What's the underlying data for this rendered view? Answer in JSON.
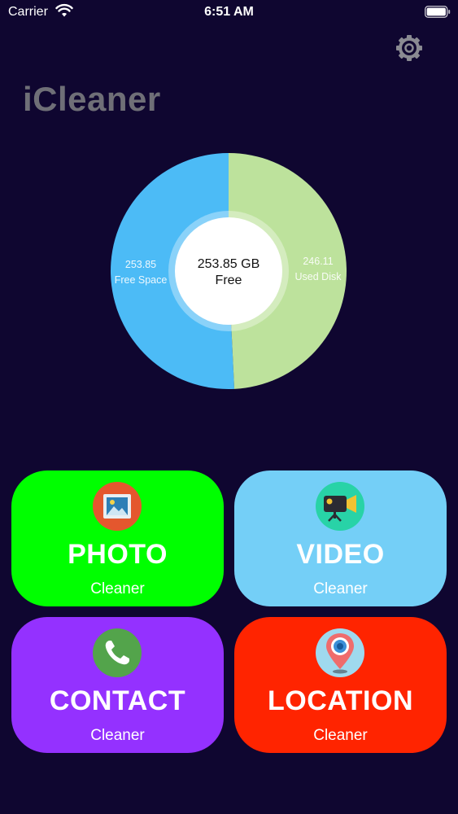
{
  "status_bar": {
    "carrier": "Carrier",
    "time": "6:51 AM"
  },
  "app": {
    "title": "iCleaner"
  },
  "disk": {
    "free_gb": 253.85,
    "used_gb": 246.11,
    "center_value": "253.85 GB",
    "center_label": "Free",
    "free_value": "253.85",
    "free_label": "Free Space",
    "used_value": "246.11",
    "used_label": "Used Disk",
    "free_color": "#4cbbf6",
    "used_color": "#bde29c"
  },
  "cards": {
    "photo": {
      "title": "PHOTO",
      "subtitle": "Cleaner",
      "color": "#00ff00",
      "icon": "photo-icon"
    },
    "video": {
      "title": "VIDEO",
      "subtitle": "Cleaner",
      "color": "#74cff7",
      "icon": "video-camera-icon"
    },
    "contact": {
      "title": "CONTACT",
      "subtitle": "Cleaner",
      "color": "#9431ff",
      "icon": "phone-icon"
    },
    "location": {
      "title": "LOCATION",
      "subtitle": "Cleaner",
      "color": "#ff2400",
      "icon": "location-pin-icon"
    }
  },
  "colors": {
    "background": "#0f0630",
    "title": "#6f6f77"
  }
}
